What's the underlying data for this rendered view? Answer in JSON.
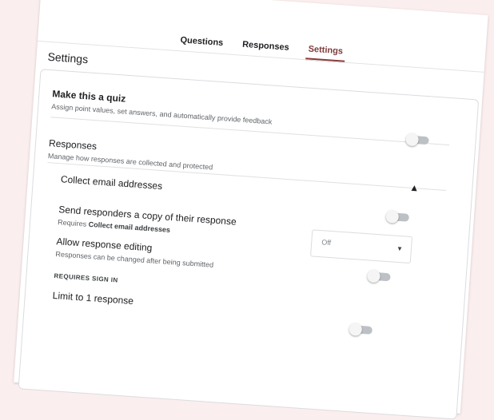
{
  "tabs": [
    {
      "label": "Questions",
      "active": false
    },
    {
      "label": "Responses",
      "active": false
    },
    {
      "label": "Settings",
      "active": true
    }
  ],
  "page_title": "Settings",
  "quiz": {
    "title": "Make this a quiz",
    "description": "Assign point values, set answers, and automatically provide feedback",
    "enabled": false
  },
  "responses": {
    "title": "Responses",
    "description": "Manage how responses are collected and protected",
    "collect_email": {
      "label": "Collect email addresses",
      "expanded": true
    },
    "send_copy": {
      "title": "Send responders a copy of their response",
      "requires_prefix": "Requires",
      "requires_target": "Collect email addresses",
      "enabled": false
    },
    "copy_select": {
      "value": "Off",
      "arrow_icon": "dropdown-arrow-icon"
    },
    "edit": {
      "title": "Allow response editing",
      "description": "Responses can be changed after being submitted",
      "enabled": false
    },
    "requires_sign_in_label": "REQUIRES SIGN IN",
    "limit": {
      "title": "Limit to 1 response",
      "enabled": false
    }
  },
  "colors": {
    "accent": "#8a3a3a",
    "background": "#fbeeee",
    "toggle_off": "#bdc1c6"
  }
}
